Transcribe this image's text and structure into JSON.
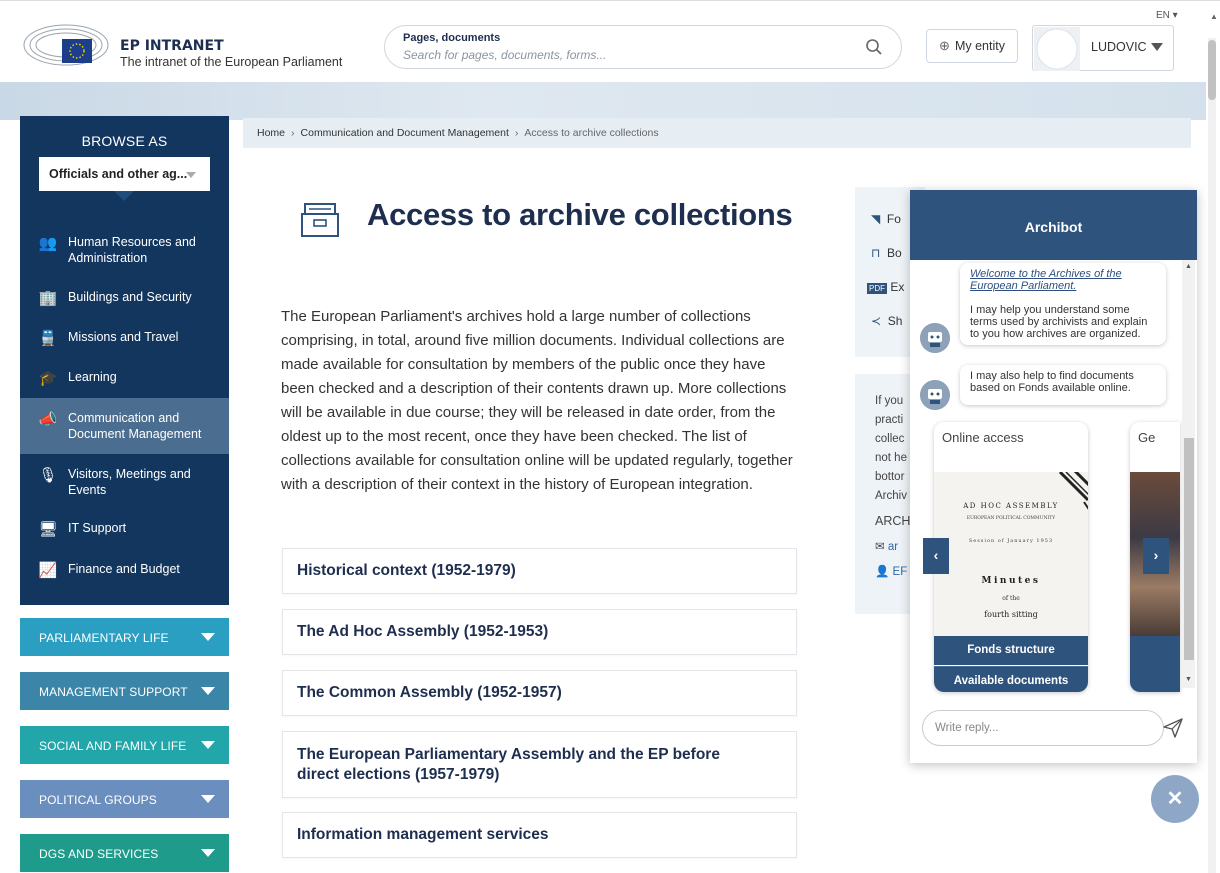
{
  "header": {
    "brand_title": "EP INTRANET",
    "brand_subtitle": "The intranet of the European Parliament",
    "search_label": "Pages, documents",
    "search_placeholder": "Search for pages, documents, forms...",
    "entity_label": "My entity",
    "user_name": "LUDOVIC",
    "language": "EN"
  },
  "sidebar": {
    "browse_title": "BROWSE AS",
    "browse_value": "Officials and other ag...",
    "items": [
      {
        "label": "Human Resources and Administration",
        "icon": "people-icon"
      },
      {
        "label": "Buildings and Security",
        "icon": "building-icon"
      },
      {
        "label": "Missions and Travel",
        "icon": "train-icon"
      },
      {
        "label": "Learning",
        "icon": "graduation-cap-icon"
      },
      {
        "label": "Communication and Document Management",
        "icon": "megaphone-icon"
      },
      {
        "label": "Visitors, Meetings and Events",
        "icon": "microphone-icon"
      },
      {
        "label": "IT Support",
        "icon": "monitor-icon"
      },
      {
        "label": "Finance and Budget",
        "icon": "chart-line-icon"
      }
    ],
    "categories": [
      {
        "label": "PARLIAMENTARY LIFE",
        "color": "#2a9fc2"
      },
      {
        "label": "MANAGEMENT SUPPORT",
        "color": "#3b86a8"
      },
      {
        "label": "SOCIAL AND FAMILY LIFE",
        "color": "#22a6a9"
      },
      {
        "label": "POLITICAL GROUPS",
        "color": "#6a8fbf"
      },
      {
        "label": "DGS AND SERVICES",
        "color": "#1f9b8b"
      }
    ]
  },
  "breadcrumb": {
    "home": "Home",
    "level1": "Communication and Document Management",
    "current": "Access to archive collections"
  },
  "main": {
    "title": "Access to archive collections",
    "intro": "The European Parliament's archives hold a large number of collections comprising, in total, around five million documents. Individual collections are made available for consultation by members of the public once they have been checked and a description of their contents drawn up. More collections will be available in due course; they will be released in date order, from the oldest up to the most recent, once they have been checked. The list of collections available for consultation online will be updated regularly, together with a description of their context in the history of European integration.",
    "sections": [
      "Historical context (1952-1979)",
      "The Ad Hoc Assembly (1952-1953)",
      "The Common Assembly (1952-1957)",
      "The European Parliamentary Assembly and the EP before direct elections (1957-1979)",
      "Information management services"
    ]
  },
  "side": {
    "actions": [
      "Fo",
      "Bo",
      "Ex",
      "Sh"
    ],
    "pdf_badge": "PDF",
    "info_lines": [
      "If you",
      "practi",
      "collec",
      "not he",
      "bottor",
      "Archiv"
    ],
    "archi_label": "ARCHI",
    "email_stub": "ar",
    "person_stub": "EF"
  },
  "chat": {
    "title": "Archibot",
    "msg1_link": "Welcome to the Archives of the European Parliament.",
    "msg1_text": "I may help you understand some terms used by archivists and explain to you how archives are organized.",
    "msg2_text": "I may also help to find documents based on Fonds available online.",
    "card_title": "Online access",
    "card2_title": "Ge",
    "card_btn1": "Fonds structure",
    "card_btn2": "Available documents",
    "doc_heading": "AD HOC ASSEMBLY",
    "doc_sub": "EUROPEAN POLITICAL COMMUNITY",
    "doc_session": "Session of January 1953",
    "doc_minutes": "Minutes",
    "doc_of": "of the",
    "doc_sitting": "fourth sitting",
    "reply_placeholder": "Write reply..."
  },
  "colors": {
    "primary_navy": "#12365e",
    "chat_blue": "#2e537c",
    "title_navy": "#1e2e4f"
  }
}
